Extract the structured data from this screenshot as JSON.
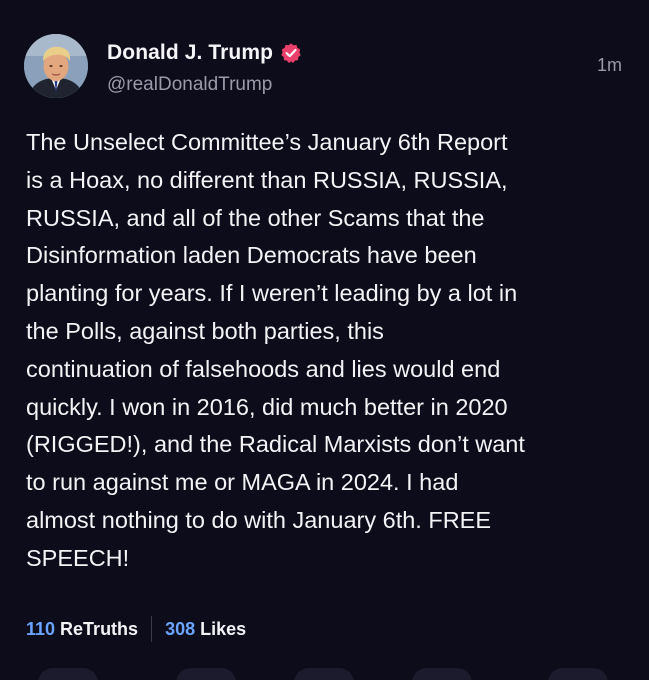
{
  "post": {
    "author": {
      "display_name": "Donald J. Trump",
      "handle": "@realDonaldTrump",
      "verified_icon": "verified-badge-icon",
      "avatar": "avatar-photo"
    },
    "timestamp": "1m",
    "text": "The Unselect Committee’s January 6th Report\nis a Hoax, no different than RUSSIA, RUSSIA,\nRUSSIA, and all of the other Scams that the\nDisinformation laden Democrats have been\nplanting for years. If I weren’t leading by a lot in\nthe Polls, against both parties, this\ncontinuation of falsehoods and lies would end\nquickly. I won in 2016, did much better in 2020\n(RIGGED!), and the Radical Marxists don’t want\nto run against me or MAGA in 2024. I had\nalmost nothing to do with January 6th. FREE\nSPEECH!",
    "stats": {
      "retruths_count": "110",
      "retruths_label": "ReTruths",
      "likes_count": "308",
      "likes_label": "Likes"
    }
  },
  "colors": {
    "background": "#0d0c1a",
    "accent": "#6aa4ff",
    "verified": "#e8406a",
    "secondary_text": "#9a9aab"
  }
}
